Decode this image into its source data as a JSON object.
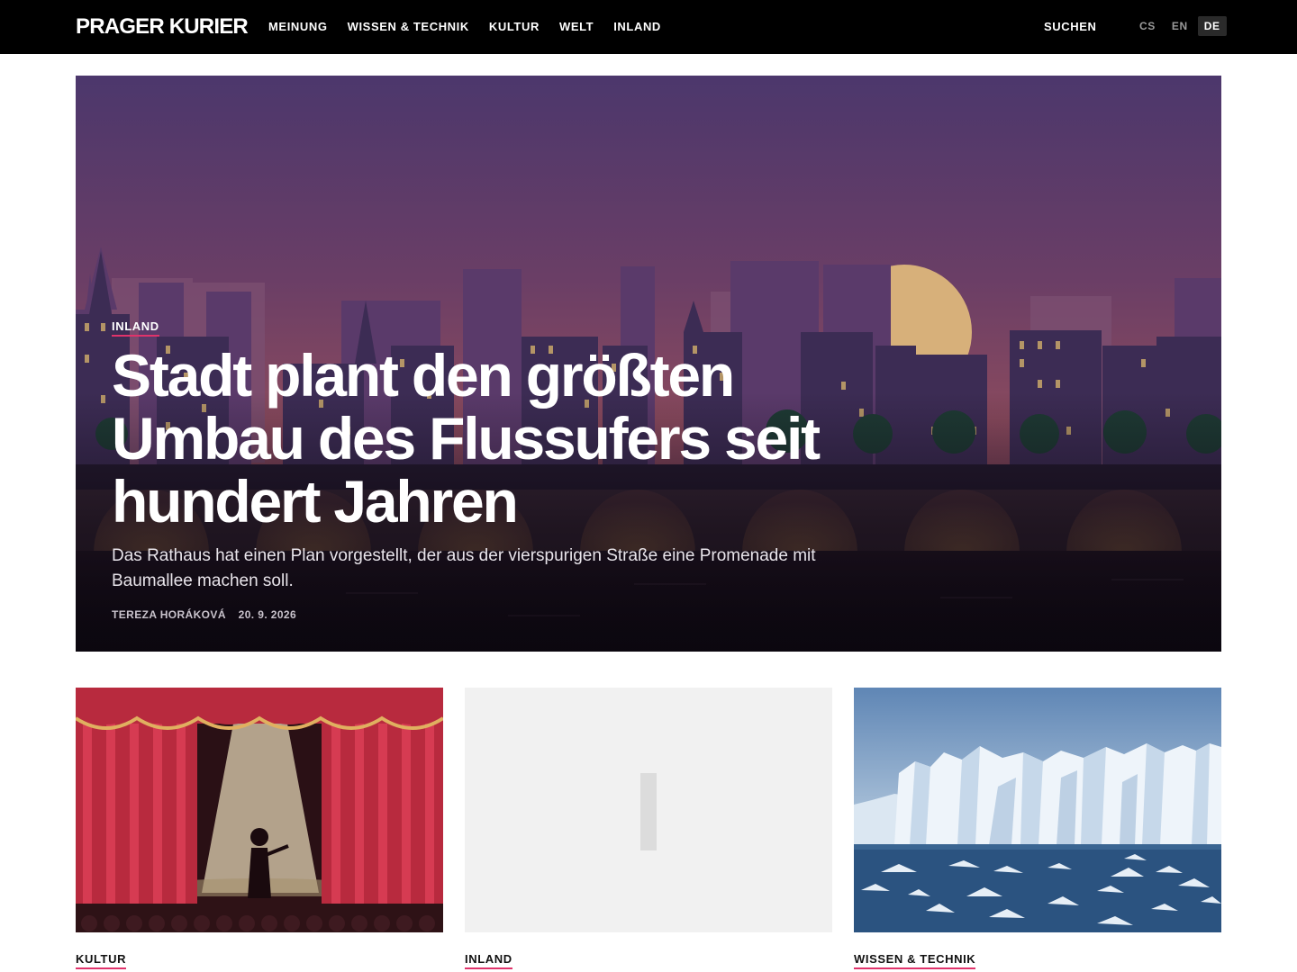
{
  "header": {
    "logo": "PRAGER KURIER",
    "nav": [
      {
        "label": "MEINUNG"
      },
      {
        "label": "WISSEN & TECHNIK"
      },
      {
        "label": "KULTUR"
      },
      {
        "label": "WELT"
      },
      {
        "label": "INLAND"
      }
    ],
    "search_label": "SUCHEN",
    "languages": [
      {
        "code": "CS",
        "active": false
      },
      {
        "code": "EN",
        "active": false
      },
      {
        "code": "DE",
        "active": true
      }
    ]
  },
  "hero": {
    "kicker": "INLAND",
    "title": "Stadt plant den größten Umbau des Flussufers seit hundert Jahren",
    "dek": "Das Rathaus hat einen Plan vorgestellt, der aus der vierspurigen Straße eine Promenade mit Baumallee machen soll.",
    "author": "TEREZA HORÁKOVÁ",
    "date": "20. 9. 2026"
  },
  "cards": [
    {
      "kicker": "KULTUR",
      "image": "theater-stage-illustration"
    },
    {
      "kicker": "INLAND",
      "image": "image-placeholder"
    },
    {
      "kicker": "WISSEN & TECHNIK",
      "image": "glacier-illustration"
    }
  ],
  "colors": {
    "accent": "#e0336b",
    "header_bg": "#000000",
    "page_bg": "#ffffff"
  }
}
